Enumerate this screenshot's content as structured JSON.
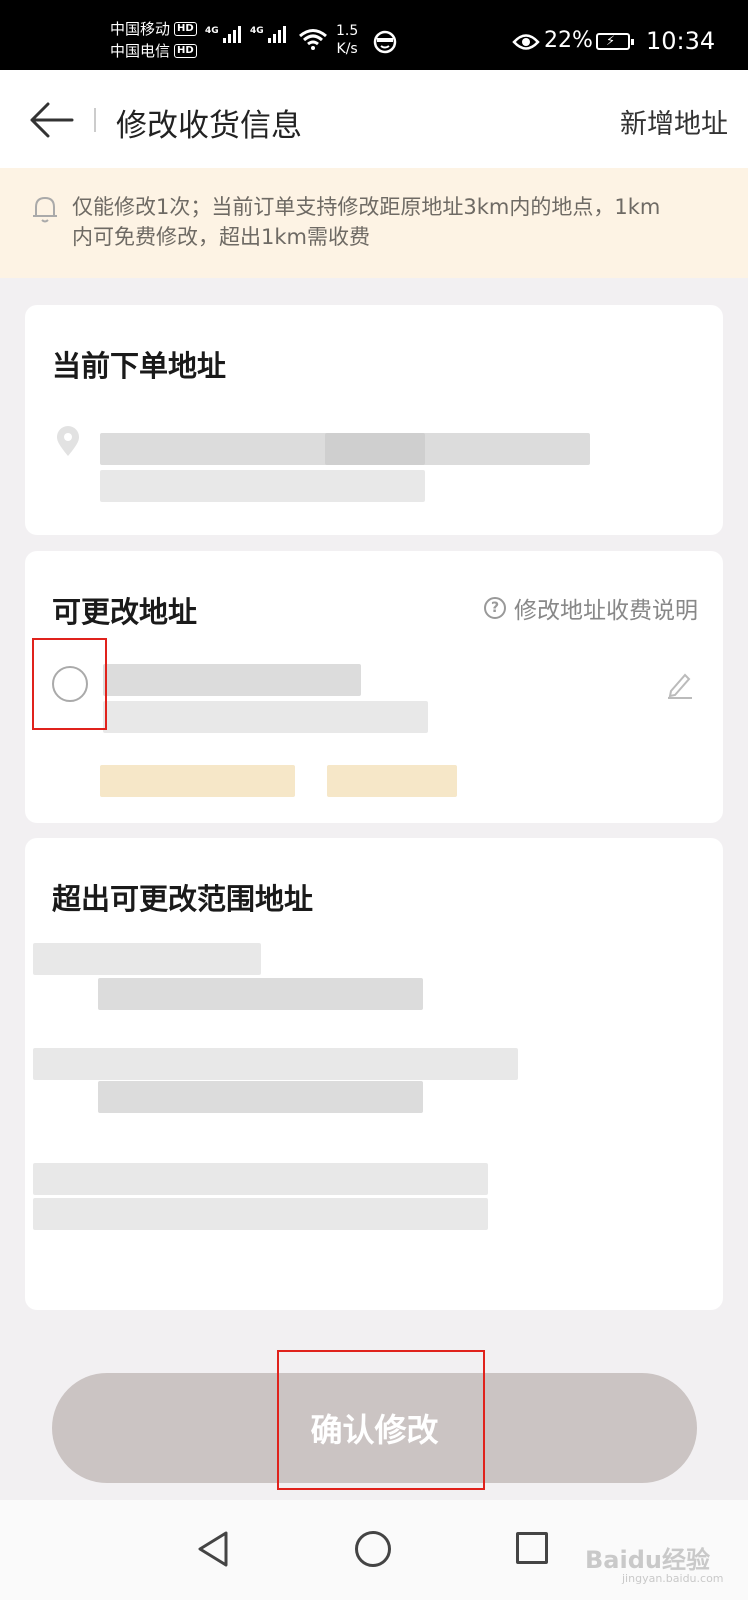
{
  "status_bar": {
    "carrier_1": "中国移动",
    "carrier_2": "中国电信",
    "hd_badge": "HD",
    "network_label": "4G",
    "speed_value": "1.5",
    "speed_unit": "K/s",
    "battery_percent": "22%",
    "time": "10:34"
  },
  "header": {
    "title": "修改收货信息",
    "action_label": "新增地址"
  },
  "notice": {
    "text": "仅能修改1次；当前订单支持修改距原地址3km内的地点，1km内可免费修改，超出1km需收费"
  },
  "current_address_card": {
    "title": "当前下单地址"
  },
  "changeable_card": {
    "title": "可更改地址",
    "help_label": "修改地址收费说明"
  },
  "out_of_range_card": {
    "title": "超出可更改范围地址"
  },
  "confirm_button": {
    "label": "确认修改",
    "enabled": false
  },
  "watermark": {
    "brand": "Baidu经验",
    "url": "jingyan.baidu.com"
  },
  "colors": {
    "notice_bg": "#fdf3e4",
    "confirm_disabled_bg": "#cbc4c3",
    "highlight_red": "#e0221c"
  }
}
